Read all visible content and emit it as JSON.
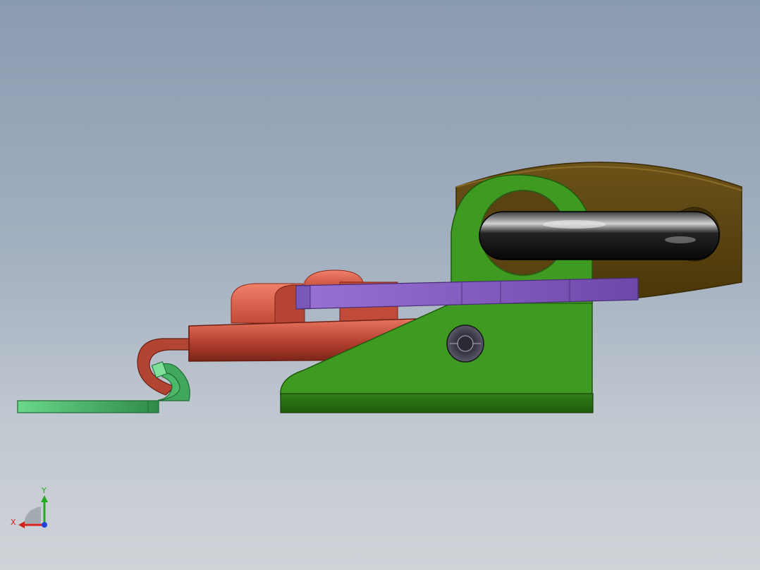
{
  "viewport": {
    "background_top": "#8a9bb0",
    "background_bottom": "#cfd3d8"
  },
  "model": {
    "parts": [
      {
        "name": "base-plate",
        "color": "#3f9a22"
      },
      {
        "name": "latch-hook",
        "color": "#d95a44"
      },
      {
        "name": "lever-handle",
        "color": "#8a5fc0"
      },
      {
        "name": "mounting-bracket",
        "color": "#5a4310"
      },
      {
        "name": "catch-plate",
        "color": "#5fc77a"
      },
      {
        "name": "grip-ring",
        "color": "#1a1a1a"
      }
    ]
  },
  "triad": {
    "x_label": "X",
    "y_label": "Y",
    "x_color": "#d42020",
    "y_color": "#22aa22",
    "z_color": "#2244dd"
  }
}
